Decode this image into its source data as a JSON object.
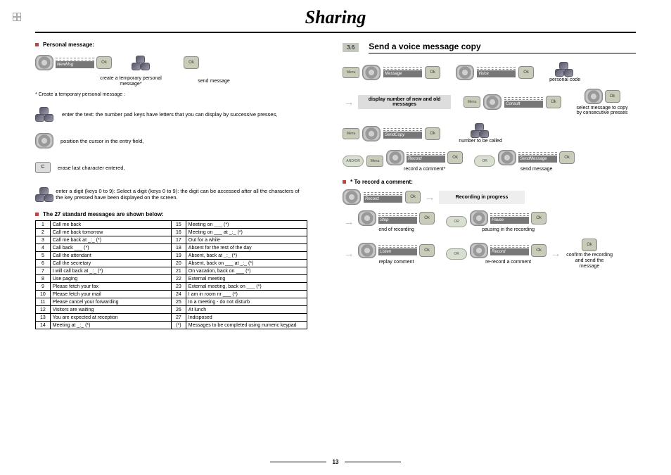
{
  "title": "Sharing",
  "page_number": "13",
  "left": {
    "personal_message_h": "Personal message:",
    "strip1": "NewMsg",
    "caption1": "create a temporary personal message*",
    "caption2": "send message",
    "footnote1": "* Create a temporary personal message :",
    "steps": [
      "enter the text: the number pad keys have letters that you can display by successive presses,",
      "position the cursor in the entry field,",
      "erase last character entered,",
      "enter a digit (keys 0 to 9): Select a digit (keys 0 to 9): the digit can be accessed after all the characters of the key pressed have been displayed on the screen."
    ],
    "table_h": "The 27 standard messages are shown below:",
    "messages": [
      [
        "1",
        "Call me back",
        "15",
        "Meeting on ___ (*)"
      ],
      [
        "2",
        "Call me back tomorrow",
        "16",
        "Meeting on ___ at _:_ (*)"
      ],
      [
        "3",
        "Call me back at _:_ (*)",
        "17",
        "Out for a while"
      ],
      [
        "4",
        "Call back ___ (*)",
        "18",
        "Absent for the rest of the day"
      ],
      [
        "5",
        "Call the attendant",
        "19",
        "Absent, back at _:_ (*)"
      ],
      [
        "6",
        "Call the secretary",
        "20",
        "Absent, back on ___ at _:_ (*)"
      ],
      [
        "7",
        "I will call back at _:_ (*)",
        "21",
        "On vacation, back on ___ (*)"
      ],
      [
        "8",
        "Use paging",
        "22",
        "External meeting"
      ],
      [
        "9",
        "Please fetch your fax",
        "23",
        "External meeting, back on ___ (*)"
      ],
      [
        "10",
        "Please fetch your mail",
        "24",
        "I am in room nr ___ (*)"
      ],
      [
        "11",
        "Please cancel your forwarding",
        "25",
        "In a meeting - do not disturb"
      ],
      [
        "12",
        "Visitors are waiting",
        "26",
        "At lunch"
      ],
      [
        "13",
        "You are expected at reception",
        "27",
        "Indisposed"
      ],
      [
        "14",
        "Meeting at _:_ (*)",
        "(*)",
        "Messages to be completed using numeric keypad"
      ]
    ]
  },
  "right": {
    "sec_num": "3.6",
    "sec_title": "Send a voice message copy",
    "menu_label": "Menu",
    "ok_label": "Ok",
    "or_label": "OR",
    "andor_label": "AND/OR",
    "strips": {
      "message": "Message",
      "voice": "Voice",
      "consult": "Consult",
      "sendcopy": "SendCopy",
      "record": "Record",
      "sendmessage": "SendMessage",
      "stop": "Stop",
      "pause": "Pause",
      "listen": "Listen"
    },
    "captions": {
      "personal_code": "personal code",
      "display_msgs": "display number of new and old messages",
      "select_msg": "select message to copy by consecutive presses",
      "number_called": "number to be called",
      "record_comment": "record a comment*",
      "send_message": "send message",
      "rec_in_progress": "Recording in progress",
      "end_of_recording": "end of recording",
      "pausing": "pausing in the recording",
      "replay": "replay comment",
      "rerecord": "re-record a comment",
      "confirm": "confirm the recording and send the message"
    },
    "sub_h": "* To record a comment:"
  }
}
